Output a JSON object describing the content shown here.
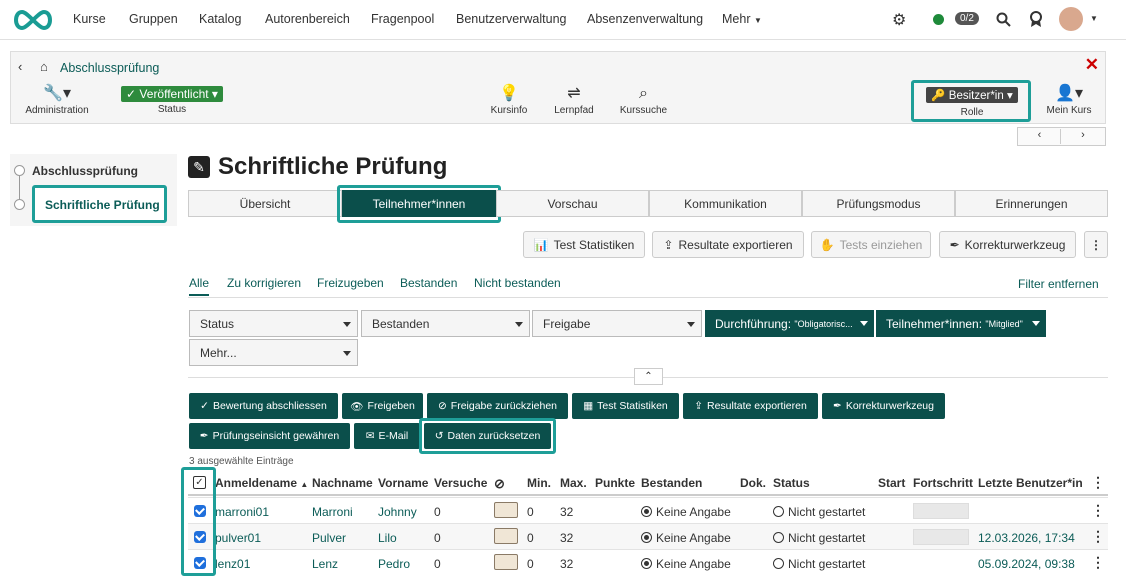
{
  "topnav": {
    "items": [
      "Kurse",
      "Gruppen",
      "Katalog",
      "Autorenbereich",
      "Fragenpool",
      "Benutzerverwaltung",
      "Absenzenverwaltung",
      "Mehr"
    ],
    "counter": "0/2"
  },
  "course": {
    "breadcrumb": "Abschlussprüfung",
    "tools": {
      "admin": "Administration",
      "status_value": "Veröffentlicht",
      "status_label": "Status",
      "kursinfo": "Kursinfo",
      "lernpfad": "Lernpfad",
      "kurssuche": "Kurssuche",
      "role_value": "Besitzer*in",
      "role_label": "Rolle",
      "mein_kurs": "Mein Kurs"
    }
  },
  "sidebar": {
    "parent": "Abschlussprüfung",
    "current": "Schriftliche Prüfung"
  },
  "page": {
    "title": "Schriftliche Prüfung",
    "tabs": [
      "Übersicht",
      "Teilnehmer*innen",
      "Vorschau",
      "Kommunikation",
      "Prüfungsmodus",
      "Erinnerungen"
    ],
    "active_tab": "Teilnehmer*innen"
  },
  "actions": {
    "test_statistiken": "Test Statistiken",
    "resultate_exportieren": "Resultate exportieren",
    "tests_einziehen": "Tests einziehen",
    "korrekturwerkzeug": "Korrekturwerkzeug"
  },
  "filters": {
    "tabs": [
      "Alle",
      "Zu korrigieren",
      "Freizugeben",
      "Bestanden",
      "Nicht bestanden"
    ],
    "remove": "Filter entfernen",
    "status": "Status",
    "bestanden": "Bestanden",
    "freigabe": "Freigabe",
    "durchfuehrung": "Durchführung:",
    "durchfuehrung_val": "\"Obligatorisc...",
    "teilnehmer": "Teilnehmer*innen:",
    "teilnehmer_val": "\"Mitglied\"",
    "mehr": "Mehr..."
  },
  "bulk": {
    "bewertung": "Bewertung abschliessen",
    "freigeben": "Freigeben",
    "freigabe_zurueck": "Freigabe zurückziehen",
    "test_statistiken": "Test Statistiken",
    "resultate": "Resultate exportieren",
    "korrektur": "Korrekturwerkzeug",
    "einsicht": "Prüfungseinsicht gewähren",
    "email": "E-Mail",
    "daten_reset": "Daten zurücksetzen",
    "selected_info": "3 ausgewählte Einträge"
  },
  "table": {
    "headers": [
      "Anmeldename",
      "Nachname",
      "Vorname",
      "Versuche",
      "Min.",
      "Max.",
      "Punkte",
      "Bestanden",
      "Dok.",
      "Status",
      "Start",
      "Fortschritt",
      "Letzte Benutzer*in"
    ],
    "rows": [
      {
        "login": "marroni01",
        "last": "Marroni",
        "first": "Johnny",
        "attempts": "0",
        "min": "0",
        "max": "32",
        "passed": "Keine Angabe",
        "status": "Nicht gestartet",
        "last_user": ""
      },
      {
        "login": "pulver01",
        "last": "Pulver",
        "first": "Lilo",
        "attempts": "0",
        "min": "0",
        "max": "32",
        "passed": "Keine Angabe",
        "status": "Nicht gestartet",
        "last_user": "12.03.2026, 17:34"
      },
      {
        "login": "lenz01",
        "last": "Lenz",
        "first": "Pedro",
        "attempts": "0",
        "min": "0",
        "max": "32",
        "passed": "Keine Angabe",
        "status": "Nicht gestartet",
        "last_user": "05.09.2024, 09:38"
      }
    ]
  }
}
